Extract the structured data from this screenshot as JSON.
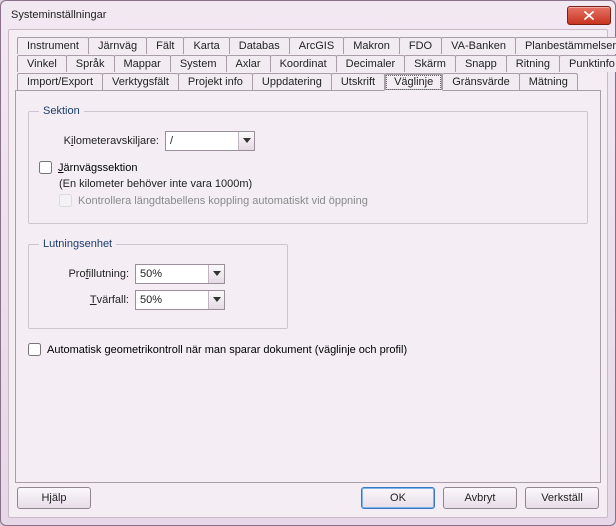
{
  "window": {
    "title": "Systeminställningar"
  },
  "tabs": {
    "row1": [
      "Instrument",
      "Järnväg",
      "Fält",
      "Karta",
      "Databas",
      "ArcGIS",
      "Makron",
      "FDO",
      "VA-Banken",
      "Planbestämmelser"
    ],
    "row2": [
      "Vinkel",
      "Språk",
      "Mappar",
      "System",
      "Axlar",
      "Koordinat",
      "Decimaler",
      "Skärm",
      "Snapp",
      "Ritning",
      "Punktinfo"
    ],
    "row3": [
      "Import/Export",
      "Verktygsfält",
      "Projekt info",
      "Uppdatering",
      "Utskrift",
      "Väglinje",
      "Gränsvärde",
      "Mätning"
    ],
    "active": "Väglinje"
  },
  "section": {
    "legend": "Sektion",
    "km_sep_label_pre": "K",
    "km_sep_label_ul": "i",
    "km_sep_label_post": "lometeravskiljare:",
    "km_sep_value": "/",
    "rail_label_pre": "",
    "rail_label_ul": "J",
    "rail_label_post": "ärnvägssektion",
    "rail_hint": "(En kilometer behöver inte vara 1000m)",
    "rail_check_label": "Kontrollera längdtabellens koppling automatiskt vid öppning"
  },
  "slope": {
    "legend": "Lutningsenhet",
    "profile_label_pre": "Pro",
    "profile_label_ul": "f",
    "profile_label_post": "illutning:",
    "profile_value": "50%",
    "cross_label_pre": "",
    "cross_label_ul": "T",
    "cross_label_post": "värfall:",
    "cross_value": "50%"
  },
  "autocheck_label": "Automatisk geometrikontroll när man sparar dokument (väglinje och profil)",
  "buttons": {
    "help": "Hjälp",
    "ok": "OK",
    "cancel": "Avbryt",
    "apply": "Verkställ"
  }
}
